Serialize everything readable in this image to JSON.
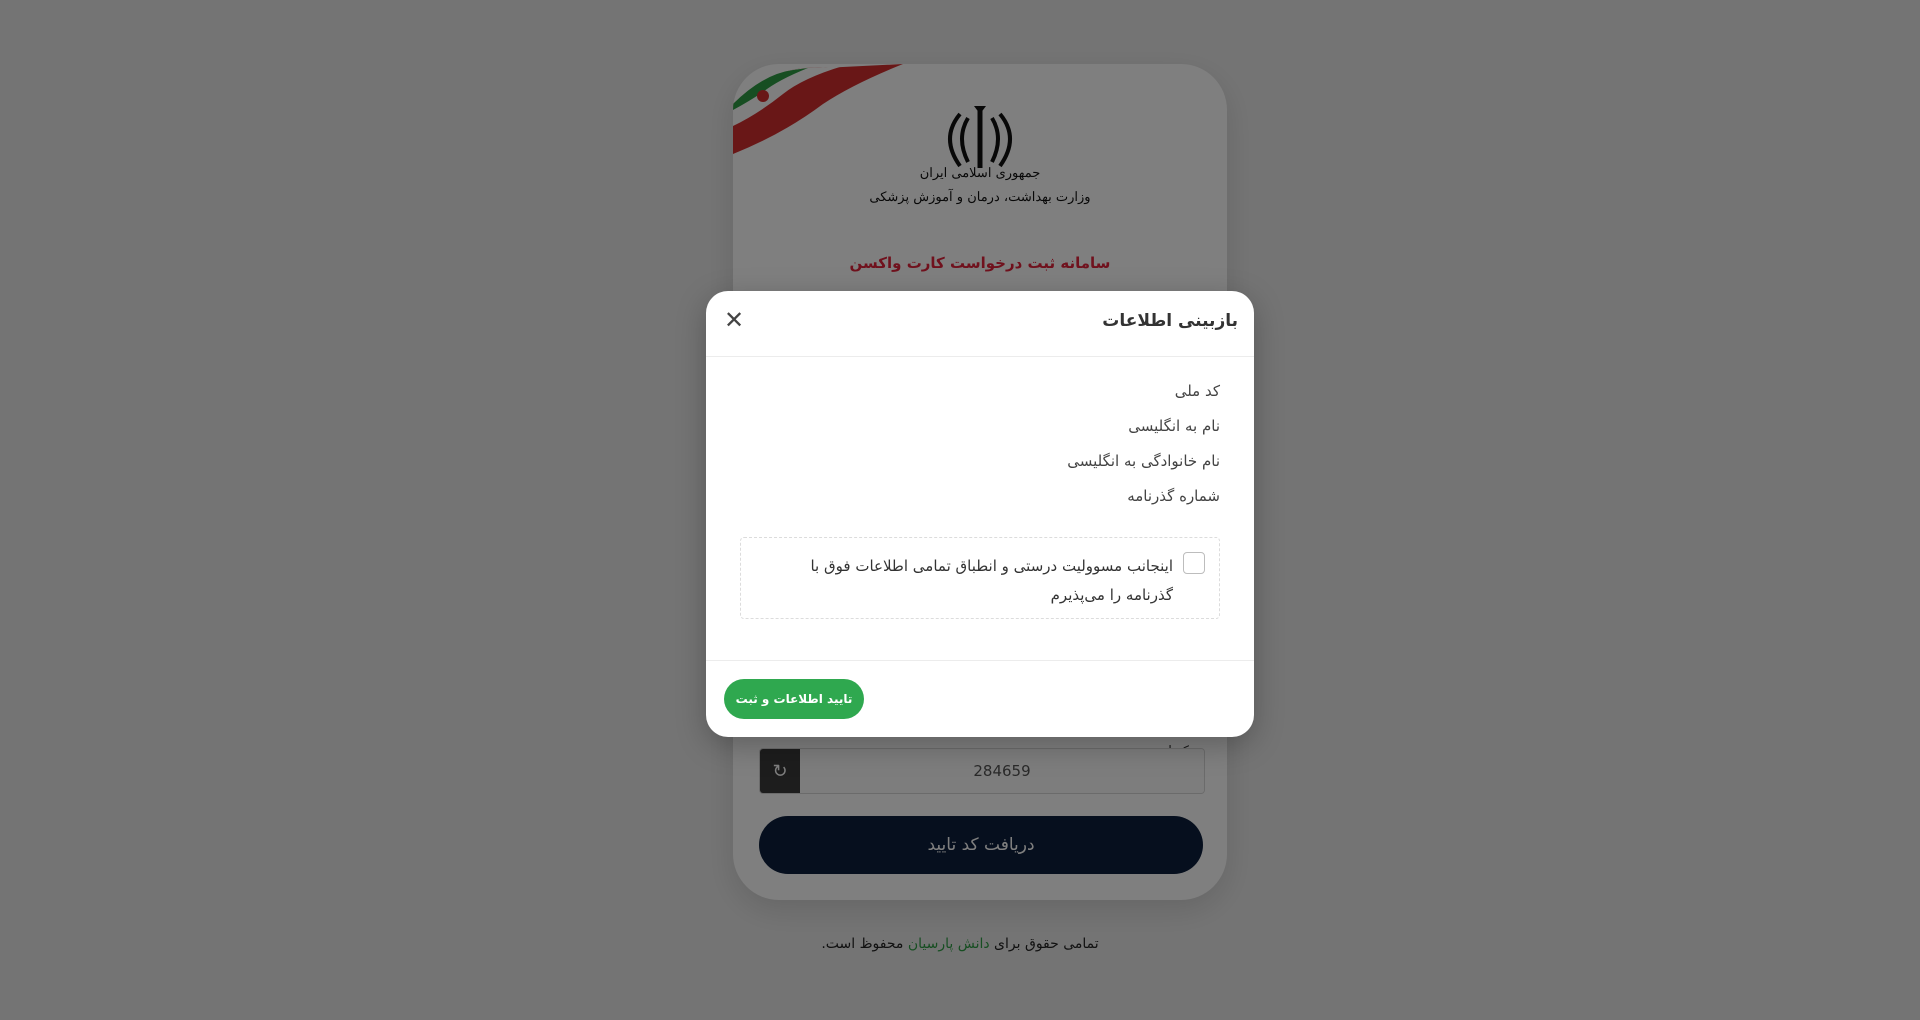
{
  "page": {
    "org_line1": "جمهوری اسلامی ایران",
    "org_line2": "وزارت بهداشت، درمان و آموزش پزشکی",
    "system_title": "سامانه ثبت درخواست کارت واکسن",
    "captcha_label": "کد امنیتی",
    "captcha_value": "284659",
    "submit_label": "دریافت کد تایید"
  },
  "footer": {
    "prefix": "تمامی حقوق برای",
    "link_text": "دانش پارسیان",
    "suffix": "محفوظ است."
  },
  "modal": {
    "title": "بازبینی اطلاعات",
    "close_symbol": "✕",
    "fields": [
      {
        "label": "کد ملی",
        "value": ""
      },
      {
        "label": "نام به انگلیسی",
        "value": ""
      },
      {
        "label": "نام خانوادگی به انگلیسی",
        "value": ""
      },
      {
        "label": "شماره گذرنامه",
        "value": ""
      }
    ],
    "agreement_text": "اینجانب مسوولیت درستی و انطباق تمامی اطلاعات فوق با گذرنامه را می‌پذیرم",
    "confirm_label": "تایید اطلاعات و ثبت"
  },
  "colors": {
    "title_red": "#e0233a",
    "confirm_green": "#2fa84f",
    "submit_navy": "#0d1f3c",
    "link_green": "#2e9d45"
  },
  "icons": {
    "close": "close-icon",
    "refresh": "refresh-icon",
    "emblem": "iran-emblem-icon",
    "flag": "iran-flag-ribbon-icon"
  }
}
